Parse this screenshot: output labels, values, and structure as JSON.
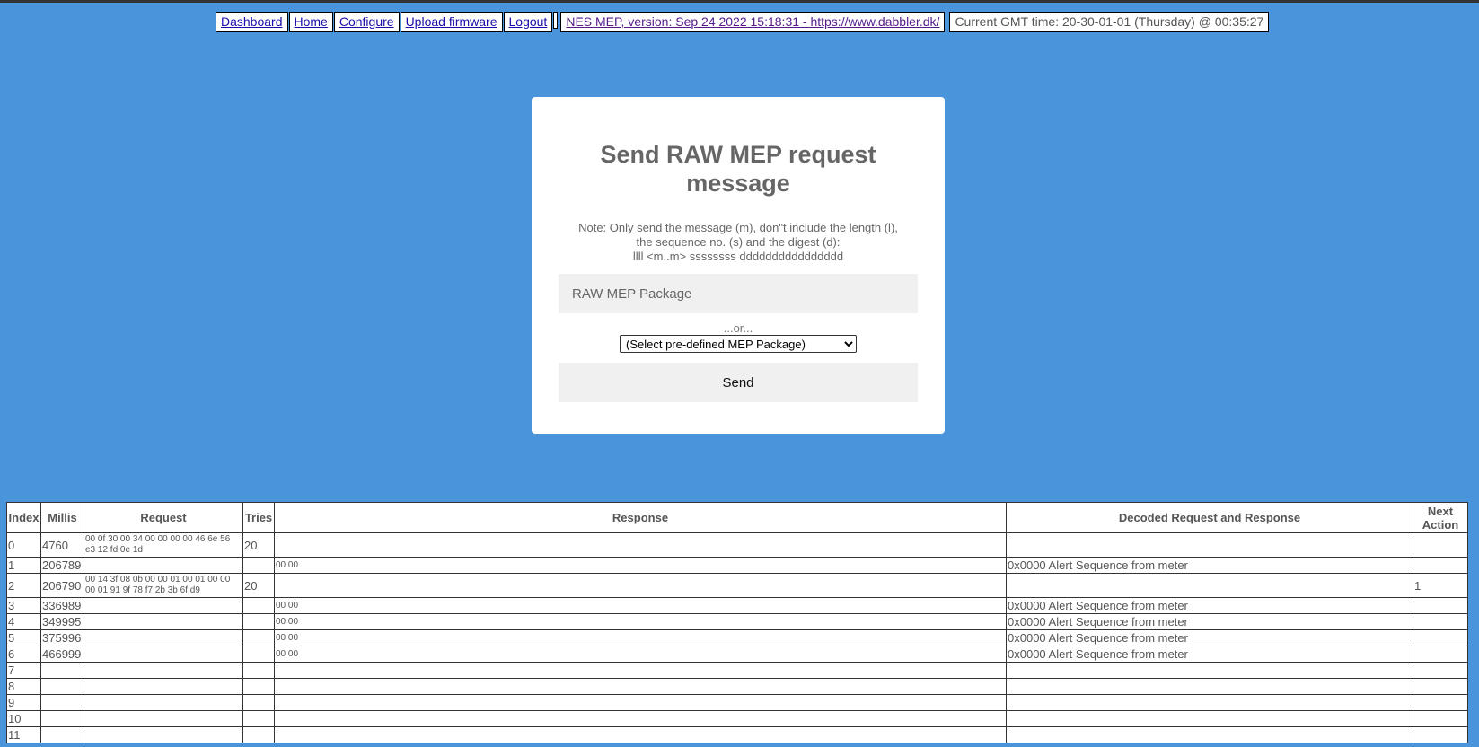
{
  "nav": {
    "links": [
      "Dashboard",
      "Home",
      "Configure",
      "Upload firmware",
      "Logout"
    ],
    "version_link": "NES MEP, version: Sep 24 2022 15:18:31 - https://www.dabbler.dk/",
    "time_text": "Current GMT time: 20-30-01-01 (Thursday) @ 00:35:27"
  },
  "form": {
    "title": "Send RAW MEP request message",
    "note_lines": [
      "Note: Only send the message (m), don\"t include the length (l),",
      "the sequence no. (s) and the digest (d):",
      "llll <m..m> ssssssss dddddddddddddddd"
    ],
    "input_placeholder": "RAW MEP Package",
    "or_text": "...or...",
    "select_value": "(Select pre-defined MEP Package)",
    "send_label": "Send"
  },
  "table": {
    "headers": [
      "Index",
      "Millis",
      "Request",
      "Tries",
      "Response",
      "Decoded Request and Response",
      "Next Action"
    ],
    "rows": [
      {
        "index": "0",
        "millis": "4760",
        "request": "00 0f 30 00 34 00 00 00 00 46 6e 56 e3 12 fd 0e 1d",
        "tries": "20",
        "response": "",
        "decoded": "",
        "next": ""
      },
      {
        "index": "1",
        "millis": "206789",
        "request": "",
        "tries": "",
        "response": "00 00",
        "decoded": "0x0000 Alert Sequence from meter",
        "next": ""
      },
      {
        "index": "2",
        "millis": "206790",
        "request": "00 14 3f 08 0b 00 00 01 00 01 00 00 00 01 91 9f 78 f7 2b 3b 6f d9",
        "tries": "20",
        "response": "",
        "decoded": "",
        "next": "1"
      },
      {
        "index": "3",
        "millis": "336989",
        "request": "",
        "tries": "",
        "response": "00 00",
        "decoded": "0x0000 Alert Sequence from meter",
        "next": ""
      },
      {
        "index": "4",
        "millis": "349995",
        "request": "",
        "tries": "",
        "response": "00 00",
        "decoded": "0x0000 Alert Sequence from meter",
        "next": ""
      },
      {
        "index": "5",
        "millis": "375996",
        "request": "",
        "tries": "",
        "response": "00 00",
        "decoded": "0x0000 Alert Sequence from meter",
        "next": ""
      },
      {
        "index": "6",
        "millis": "466999",
        "request": "",
        "tries": "",
        "response": "00 00",
        "decoded": "0x0000 Alert Sequence from meter",
        "next": ""
      },
      {
        "index": "7",
        "millis": "",
        "request": "",
        "tries": "",
        "response": "",
        "decoded": "",
        "next": ""
      },
      {
        "index": "8",
        "millis": "",
        "request": "",
        "tries": "",
        "response": "",
        "decoded": "",
        "next": ""
      },
      {
        "index": "9",
        "millis": "",
        "request": "",
        "tries": "",
        "response": "",
        "decoded": "",
        "next": ""
      },
      {
        "index": "10",
        "millis": "",
        "request": "",
        "tries": "",
        "response": "",
        "decoded": "",
        "next": ""
      },
      {
        "index": "11",
        "millis": "",
        "request": "",
        "tries": "",
        "response": "",
        "decoded": "",
        "next": ""
      }
    ]
  }
}
